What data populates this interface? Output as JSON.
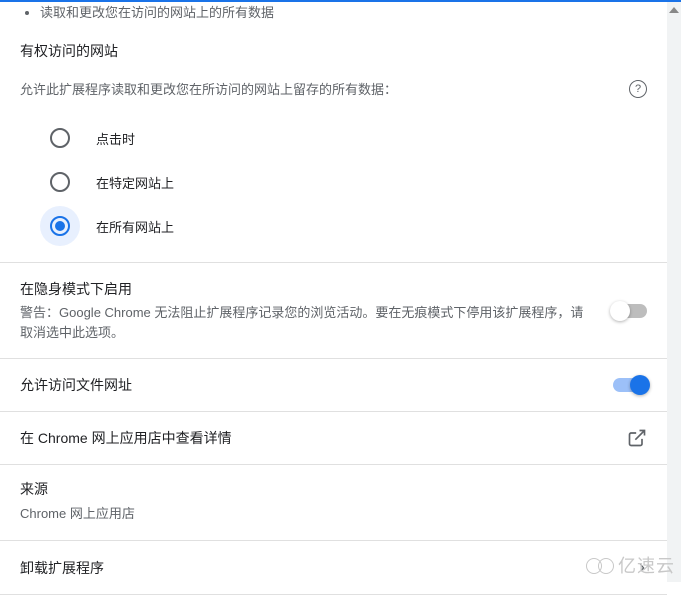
{
  "partial_bullet": "读取和更改您在访问的网站上的所有数据",
  "site_access": {
    "heading": "有权访问的网站",
    "description": "允许此扩展程序读取和更改您在所访问的网站上留存的所有数据：",
    "help_icon": "?",
    "options": [
      {
        "label": "点击时",
        "selected": false
      },
      {
        "label": "在特定网站上",
        "selected": false
      },
      {
        "label": "在所有网站上",
        "selected": true
      }
    ]
  },
  "incognito": {
    "title": "在隐身模式下启用",
    "warning": "警告：Google Chrome 无法阻止扩展程序记录您的浏览活动。要在无痕模式下停用该扩展程序，请取消选中此选项。",
    "enabled": false
  },
  "file_urls": {
    "title": "允许访问文件网址",
    "enabled": true
  },
  "store_link": {
    "title": "在 Chrome 网上应用店中查看详情"
  },
  "source": {
    "title": "来源",
    "value": "Chrome 网上应用店"
  },
  "remove": {
    "title": "卸载扩展程序"
  },
  "watermark": "亿速云"
}
